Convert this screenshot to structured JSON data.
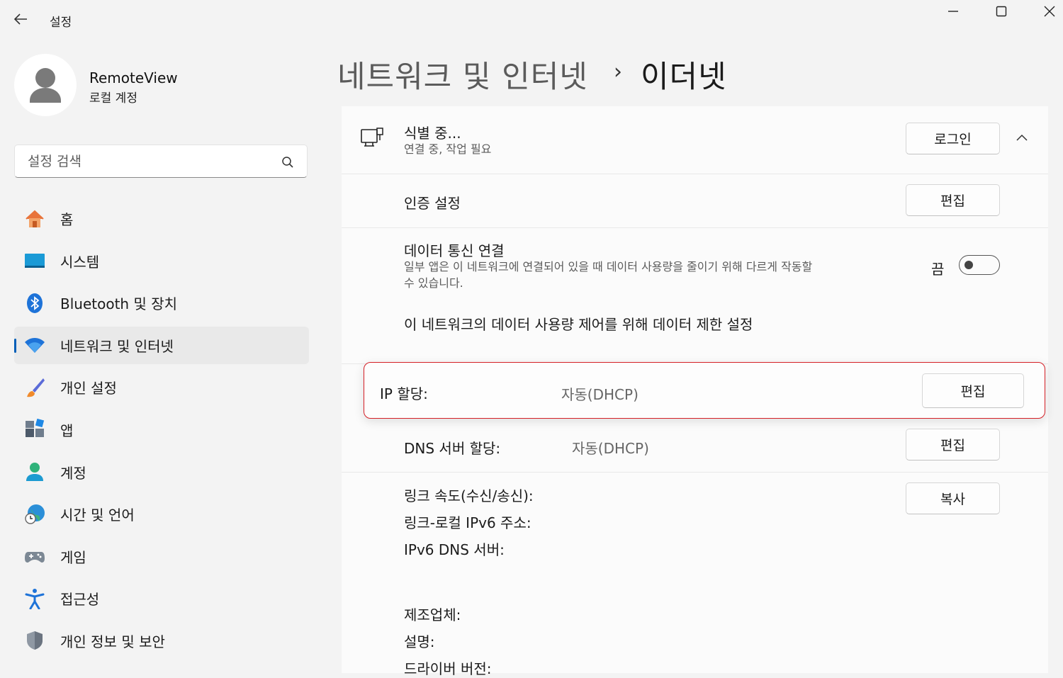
{
  "window": {
    "title": "설정",
    "controls": [
      "minimize-icon",
      "maximize-icon",
      "close-icon"
    ]
  },
  "profile": {
    "name": "RemoteView",
    "account_type": "로컬 계정"
  },
  "search": {
    "placeholder": "설정 검색"
  },
  "nav": {
    "selected": "네트워크 및 인터넷",
    "items": [
      {
        "label": "홈",
        "icon": "home-icon"
      },
      {
        "label": "시스템",
        "icon": "system-icon"
      },
      {
        "label": "Bluetooth 및 장치",
        "icon": "bluetooth-icon"
      },
      {
        "label": "네트워크 및 인터넷",
        "icon": "wifi-icon"
      },
      {
        "label": "개인 설정",
        "icon": "brush-icon"
      },
      {
        "label": "앱",
        "icon": "apps-icon"
      },
      {
        "label": "계정",
        "icon": "person-icon"
      },
      {
        "label": "시간 및 언어",
        "icon": "globe-clock-icon"
      },
      {
        "label": "게임",
        "icon": "gamepad-icon"
      },
      {
        "label": "접근성",
        "icon": "accessibility-icon"
      },
      {
        "label": "개인 정보 및 보안",
        "icon": "shield-icon"
      }
    ]
  },
  "breadcrumb": {
    "parent": "네트워크 및 인터넷",
    "separator": "›",
    "current": "이더넷"
  },
  "network": {
    "name": "식별 중...",
    "status": "연결 중, 작업 필요",
    "login_button": "로그인"
  },
  "auth": {
    "label": "인증 설정",
    "edit_button": "편집"
  },
  "metered": {
    "title": "데이터 통신 연결",
    "description_line1": "일부 앱은 이 네트워크에 연결되어 있을 때 데이터 사용량을 줄이기 위해 다르게 작동할",
    "description_line2": "수 있습니다.",
    "toggle_state": "끔",
    "data_limit_link": "이 네트워크의 데이터 사용량 제어를 위해 데이터 제한 설정"
  },
  "ip": {
    "label": "IP 할당:",
    "value": "자동(DHCP)",
    "edit_button": "편집"
  },
  "dns": {
    "label": "DNS 서버 할당:",
    "value": "자동(DHCP)",
    "edit_button": "편집"
  },
  "properties": {
    "copy_button": "복사",
    "link_speed": "링크 속도(수신/송신):",
    "ipv6_local": "링크-로컬 IPv6 주소:",
    "ipv6_dns": "IPv6 DNS 서버:",
    "manufacturer": "제조업체:",
    "description": "설명:",
    "driver_version": "드라이버 버전:"
  },
  "colors": {
    "accent": "#005fb8",
    "highlight_border": "#d51f26",
    "background": "#f3f3f3"
  }
}
